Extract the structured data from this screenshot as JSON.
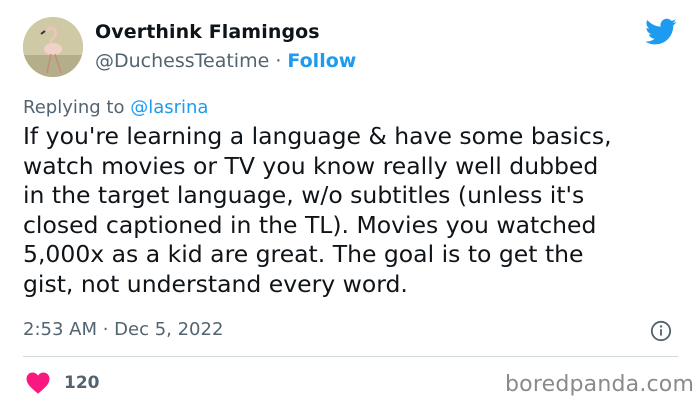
{
  "author": {
    "display_name": "Overthink Flamingos",
    "handle": "@DuchessTeatime",
    "separator": " · ",
    "follow_label": "Follow",
    "avatar_icon": "flamingo-avatar"
  },
  "brand_icon": "twitter-bird-icon",
  "reply": {
    "prefix": "Replying to ",
    "mention": "@lasrina"
  },
  "tweet": {
    "lines": [
      "If you're learning a language & have some basics,",
      "watch movies or TV you know really well dubbed",
      "in the target language, w/o subtitles (unless it's",
      "closed captioned in the TL). Movies you watched",
      "5,000x as a kid are great. The goal is to get the",
      "gist, not understand every word."
    ]
  },
  "meta": {
    "timestamp": "2:53 AM · Dec 5, 2022",
    "info_icon": "info-icon"
  },
  "engagement": {
    "like_icon": "heart-icon",
    "likes": "120"
  },
  "watermark": "boredpanda.com",
  "colors": {
    "accent": "#1d9bf0",
    "text": "#0f1419",
    "secondary": "#536471",
    "heart": "#f91880",
    "divider": "#cfd9de"
  }
}
